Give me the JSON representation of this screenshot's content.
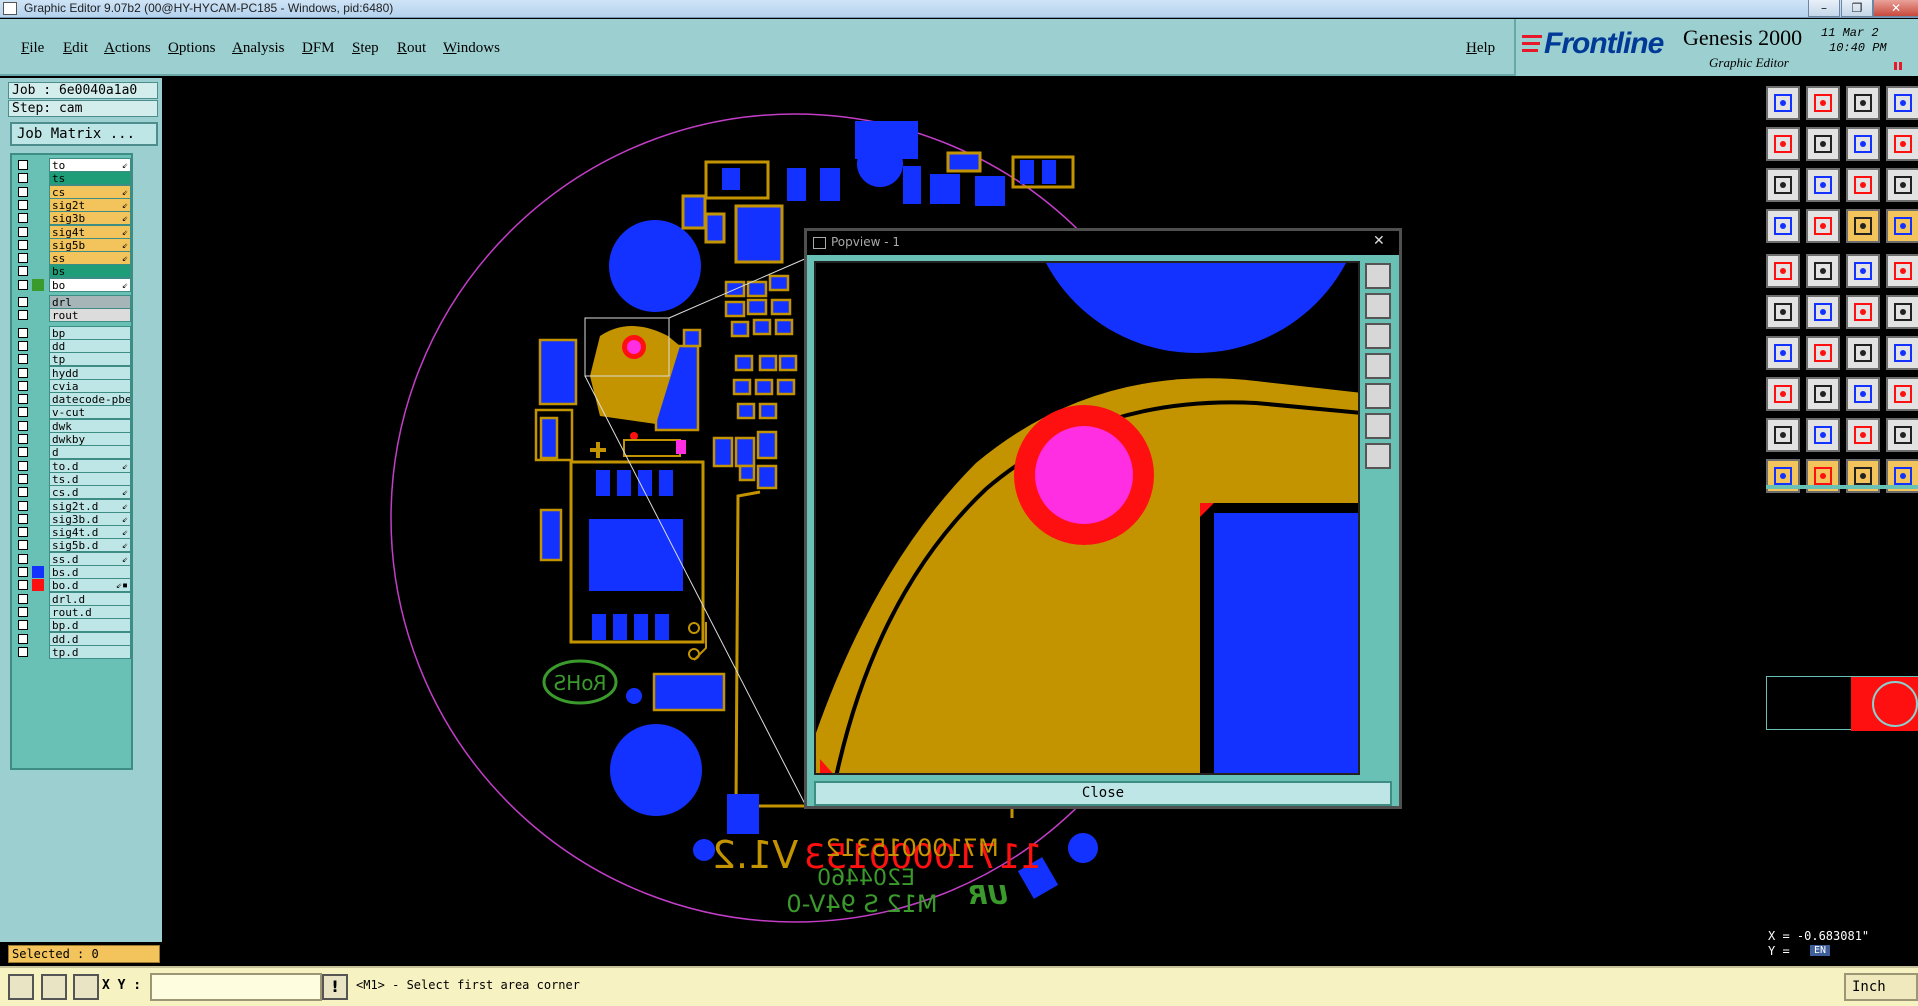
{
  "window": {
    "title": "Graphic Editor 9.07b2 (00@HY-HYCAM-PC185 - Windows, pid:6480)",
    "controls": [
      "–",
      "❐",
      "✕"
    ]
  },
  "menu": [
    "File",
    "Edit",
    "Actions",
    "Options",
    "Analysis",
    "DFM",
    "Step",
    "Rout",
    "Windows"
  ],
  "help_label": "Help",
  "brand": {
    "logo": "Frontline",
    "product": "Genesis 2000",
    "subtitle": "Graphic Editor",
    "date": "11 Mar 2",
    "time": "10:40 PM"
  },
  "job": {
    "job_line": "Job : 6e0040a1a0",
    "step_line": "Step: cam",
    "matrix_button": "Job Matrix ..."
  },
  "layers": [
    {
      "name": "to",
      "bg": "#ffffff",
      "edit": "⇙",
      "swatch": ""
    },
    {
      "name": "ts",
      "bg": "#1e9d78",
      "edit": "",
      "swatch": ""
    },
    {
      "name": "cs",
      "bg": "#f2c45b",
      "edit": "⇙",
      "swatch": ""
    },
    {
      "name": "sig2t",
      "bg": "#f2c45b",
      "edit": "⇙",
      "swatch": ""
    },
    {
      "name": "sig3b",
      "bg": "#f2c45b",
      "edit": "⇙",
      "swatch": ""
    },
    {
      "name": "sig4t",
      "bg": "#f2c45b",
      "edit": "⇙",
      "swatch": ""
    },
    {
      "name": "sig5b",
      "bg": "#f2c45b",
      "edit": "⇙",
      "swatch": ""
    },
    {
      "name": "ss",
      "bg": "#f2c45b",
      "edit": "⇙",
      "swatch": ""
    },
    {
      "name": "bs",
      "bg": "#1e9d78",
      "edit": "",
      "swatch": ""
    },
    {
      "name": "bo",
      "bg": "#ffffff",
      "edit": "⇙",
      "swatch": "#3b9a2c"
    },
    {
      "name": "drl",
      "bg": "#a6b6b8",
      "edit": "",
      "swatch": ""
    },
    {
      "name": "rout",
      "bg": "#dcdcdc",
      "edit": "",
      "swatch": ""
    },
    {
      "name": "bp",
      "bg": "#bfe6e6",
      "edit": "",
      "swatch": ""
    },
    {
      "name": "dd",
      "bg": "#bfe6e6",
      "edit": "",
      "swatch": ""
    },
    {
      "name": "tp",
      "bg": "#bfe6e6",
      "edit": "",
      "swatch": ""
    },
    {
      "name": "hydd",
      "bg": "#bfe6e6",
      "edit": "",
      "swatch": ""
    },
    {
      "name": "cvia",
      "bg": "#bfe6e6",
      "edit": "",
      "swatch": ""
    },
    {
      "name": "datecode-pbe",
      "bg": "#bfe6e6",
      "edit": "",
      "swatch": ""
    },
    {
      "name": "v-cut",
      "bg": "#bfe6e6",
      "edit": "",
      "swatch": ""
    },
    {
      "name": "dwk",
      "bg": "#bfe6e6",
      "edit": "",
      "swatch": ""
    },
    {
      "name": "dwkby",
      "bg": "#bfe6e6",
      "edit": "",
      "swatch": ""
    },
    {
      "name": "d",
      "bg": "#bfe6e6",
      "edit": "",
      "swatch": ""
    },
    {
      "name": "to.d",
      "bg": "#bfe6e6",
      "edit": "⇙",
      "swatch": ""
    },
    {
      "name": "ts.d",
      "bg": "#bfe6e6",
      "edit": "",
      "swatch": ""
    },
    {
      "name": "cs.d",
      "bg": "#bfe6e6",
      "edit": "⇙",
      "swatch": ""
    },
    {
      "name": "sig2t.d",
      "bg": "#bfe6e6",
      "edit": "⇙",
      "swatch": ""
    },
    {
      "name": "sig3b.d",
      "bg": "#bfe6e6",
      "edit": "⇙",
      "swatch": ""
    },
    {
      "name": "sig4t.d",
      "bg": "#bfe6e6",
      "edit": "⇙",
      "swatch": ""
    },
    {
      "name": "sig5b.d",
      "bg": "#bfe6e6",
      "edit": "⇙",
      "swatch": ""
    },
    {
      "name": "ss.d",
      "bg": "#bfe6e6",
      "edit": "⇙",
      "swatch": ""
    },
    {
      "name": "bs.d",
      "bg": "#bfe6e6",
      "edit": "",
      "swatch": "#1432ff"
    },
    {
      "name": "bo.d",
      "bg": "#bfe6e6",
      "edit": "⇙▪",
      "swatch": "#ff1010"
    },
    {
      "name": "drl.d",
      "bg": "#bfe6e6",
      "edit": "",
      "swatch": ""
    },
    {
      "name": "rout.d",
      "bg": "#bfe6e6",
      "edit": "",
      "swatch": ""
    },
    {
      "name": "bp.d",
      "bg": "#bfe6e6",
      "edit": "",
      "swatch": ""
    },
    {
      "name": "dd.d",
      "bg": "#bfe6e6",
      "edit": "",
      "swatch": ""
    },
    {
      "name": "tp.d",
      "bg": "#bfe6e6",
      "edit": "",
      "swatch": ""
    }
  ],
  "selected": "Selected : 0",
  "status": {
    "xy_label": "X Y :",
    "xy_value": "",
    "prompt": "<M1> - Select first area corner",
    "units": "Inch"
  },
  "coords": {
    "x": "X = -0.683081\"",
    "y": "Y =",
    "ime": "EN"
  },
  "popview": {
    "title": "Popview - 1",
    "close_label": "Close"
  },
  "board_text": {
    "rohs": "RoHS",
    "version": "V1.2",
    "code_red": "11710000153",
    "code_yellow": "M7100015312",
    "code_green1": "E204460",
    "code_green2": "M12 S 94V-0",
    "logo": "UR"
  },
  "colors": {
    "copper": "#c49400",
    "pad_blue": "#1432ff",
    "red": "#ff1010",
    "magenta": "#ff2ee2",
    "silk_green": "#3b9a2c",
    "outline": "#c23ec7",
    "ui_teal": "#9ccfd0"
  }
}
